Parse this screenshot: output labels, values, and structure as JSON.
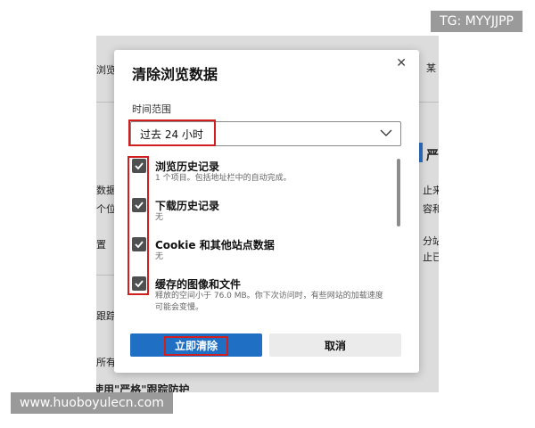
{
  "watermark_top": "TG: MYYJJPP",
  "watermark_bottom": "www.huoboyulecn.com",
  "background_fragments": {
    "left": [
      "浏览",
      "数据",
      "个位",
      "置",
      "跟踪",
      "所有"
    ],
    "right": [
      "某",
      "严",
      "止来",
      "容和",
      "分站",
      "止已"
    ],
    "bottom": "使用\"严格\"跟踪防护"
  },
  "dialog": {
    "title": "清除浏览数据",
    "time_range_label": "时间范围",
    "time_range_value": "过去 24 小时",
    "items": [
      {
        "title": "浏览历史记录",
        "desc": "1 个项目。包括地址栏中的自动完成。",
        "checked": true
      },
      {
        "title": "下载历史记录",
        "desc": "无",
        "checked": true
      },
      {
        "title": "Cookie 和其他站点数据",
        "desc": "无",
        "checked": true
      },
      {
        "title": "缓存的图像和文件",
        "desc": "释放的空间小于 76.0 MB。你下次访问时，有些网站的加载速度可能会变慢。",
        "checked": true
      }
    ],
    "clear_button": "立即清除",
    "cancel_button": "取消"
  },
  "colors": {
    "primary": "#1f6fc5",
    "highlight": "#d11e1e",
    "checkbox": "#4f4f4f",
    "overlay": "#dcdcdc"
  },
  "icons": {
    "close": "close-icon",
    "dropdown": "chevron-down-icon",
    "check": "check-icon"
  }
}
